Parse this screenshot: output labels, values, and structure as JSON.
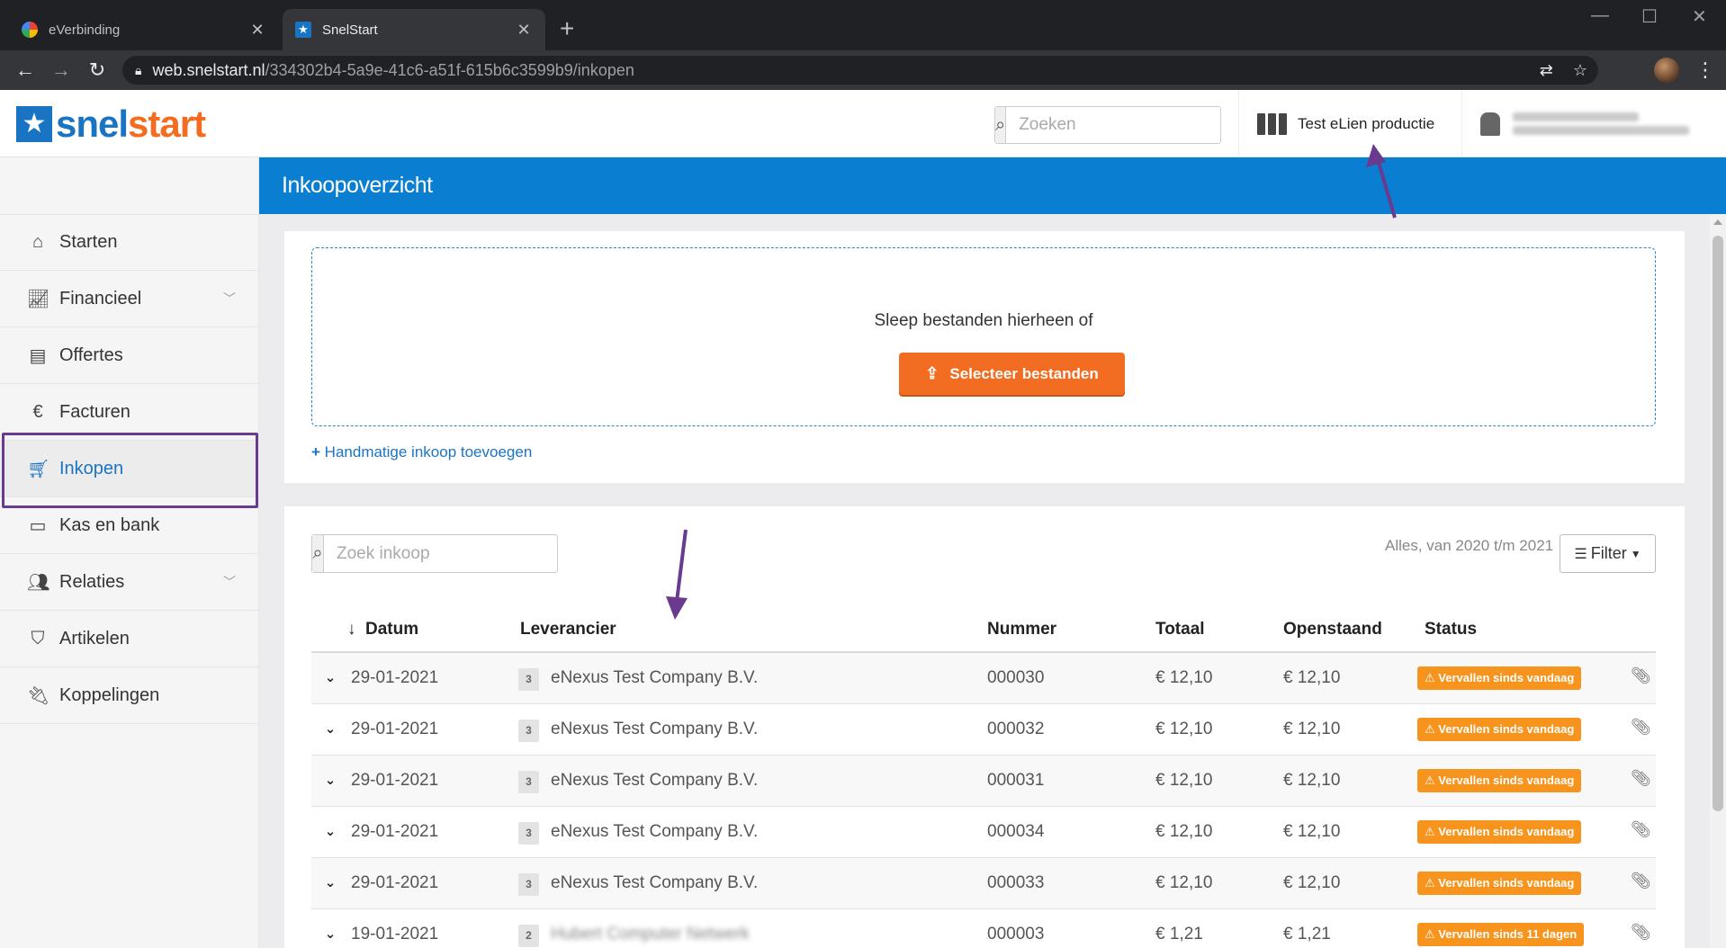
{
  "browser": {
    "tabs": [
      {
        "title": "eVerbinding",
        "active": false
      },
      {
        "title": "SnelStart",
        "active": true
      }
    ],
    "url_host": "web.snelstart.nl",
    "url_path": "/334302b4-5a9e-41c6-a51f-615b6c3599b9/inkopen"
  },
  "header": {
    "logo_a": "snel",
    "logo_b": "start",
    "search_placeholder": "Zoeken",
    "company": "Test eLien productie"
  },
  "sidebar": {
    "items": [
      {
        "label": "Starten",
        "icon": "home-icon"
      },
      {
        "label": "Financieel",
        "icon": "chart-line-icon"
      },
      {
        "label": "Offertes",
        "icon": "quote-doc-icon"
      },
      {
        "label": "Facturen",
        "icon": "invoice-icon"
      },
      {
        "label": "Inkopen",
        "icon": "cart-icon"
      },
      {
        "label": "Kas en bank",
        "icon": "money-icon"
      },
      {
        "label": "Relaties",
        "icon": "users-icon"
      },
      {
        "label": "Artikelen",
        "icon": "tag-icon"
      },
      {
        "label": "Koppelingen",
        "icon": "plug-icon"
      }
    ]
  },
  "page": {
    "title": "Inkoopoverzicht"
  },
  "upload": {
    "drop_text": "Sleep bestanden hierheen of",
    "button_label": "Selecteer bestanden",
    "manual_link": "Handmatige inkoop toevoegen"
  },
  "list": {
    "search_placeholder": "Zoek inkoop",
    "range_text": "Alles, van 2020 t/m 2021",
    "filter_label": "Filter",
    "columns": {
      "datum": "Datum",
      "leverancier": "Leverancier",
      "nummer": "Nummer",
      "totaal": "Totaal",
      "openstaand": "Openstaand",
      "status": "Status"
    },
    "rows": [
      {
        "datum": "29-01-2021",
        "badge": "3",
        "leverancier": "eNexus Test Company B.V.",
        "nummer": "000030",
        "totaal": "€ 12,10",
        "openstaand": "€ 12,10",
        "status": "Vervallen sinds vandaag",
        "blurred": false
      },
      {
        "datum": "29-01-2021",
        "badge": "3",
        "leverancier": "eNexus Test Company B.V.",
        "nummer": "000032",
        "totaal": "€ 12,10",
        "openstaand": "€ 12,10",
        "status": "Vervallen sinds vandaag",
        "blurred": false
      },
      {
        "datum": "29-01-2021",
        "badge": "3",
        "leverancier": "eNexus Test Company B.V.",
        "nummer": "000031",
        "totaal": "€ 12,10",
        "openstaand": "€ 12,10",
        "status": "Vervallen sinds vandaag",
        "blurred": false
      },
      {
        "datum": "29-01-2021",
        "badge": "3",
        "leverancier": "eNexus Test Company B.V.",
        "nummer": "000034",
        "totaal": "€ 12,10",
        "openstaand": "€ 12,10",
        "status": "Vervallen sinds vandaag",
        "blurred": false
      },
      {
        "datum": "29-01-2021",
        "badge": "3",
        "leverancier": "eNexus Test Company B.V.",
        "nummer": "000033",
        "totaal": "€ 12,10",
        "openstaand": "€ 12,10",
        "status": "Vervallen sinds vandaag",
        "blurred": false
      },
      {
        "datum": "19-01-2021",
        "badge": "2",
        "leverancier": "Hubert Computer Netwerk",
        "nummer": "000003",
        "totaal": "€ 1,21",
        "openstaand": "€ 1,21",
        "status": "Vervallen sinds 11 dagen",
        "blurred": true
      }
    ]
  },
  "colors": {
    "brand_blue": "#0a7ed1",
    "brand_orange": "#f26d21",
    "status_orange": "#f7941d",
    "annotation_purple": "#6a3a8f"
  }
}
